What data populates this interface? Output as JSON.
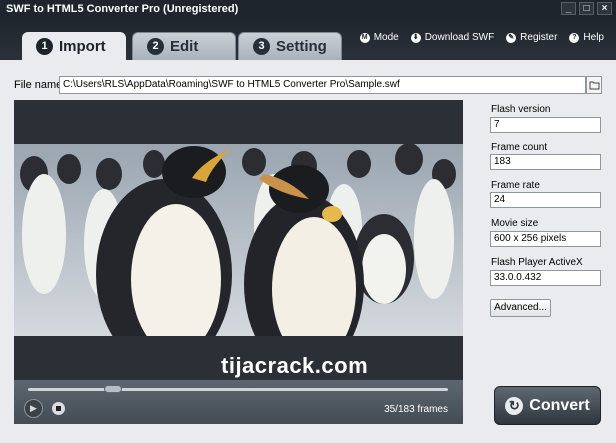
{
  "window": {
    "title": "SWF to HTML5 Converter Pro (Unregistered)",
    "controls": {
      "minimize": "_",
      "maximize": "□",
      "close": "×"
    }
  },
  "tabs": [
    {
      "number": "1",
      "label": "Import",
      "active": true
    },
    {
      "number": "2",
      "label": "Edit",
      "active": false
    },
    {
      "number": "3",
      "label": "Setting",
      "active": false
    }
  ],
  "toplinks": [
    {
      "icon": "mode-icon",
      "glyph": "M",
      "label": "Mode"
    },
    {
      "icon": "download-icon",
      "glyph": "⬇",
      "label": "Download SWF"
    },
    {
      "icon": "register-icon",
      "glyph": "✎",
      "label": "Register"
    },
    {
      "icon": "help-icon",
      "glyph": "?",
      "label": "Help"
    }
  ],
  "file": {
    "label": "File name",
    "value": "C:\\Users\\RLS\\AppData\\Roaming\\SWF to HTML5 Converter Pro\\Sample.swf"
  },
  "info": {
    "flash_version": {
      "label": "Flash version",
      "value": "7"
    },
    "frame_count": {
      "label": "Frame count",
      "value": "183"
    },
    "frame_rate": {
      "label": "Frame rate",
      "value": "24"
    },
    "movie_size": {
      "label": "Movie size",
      "value": "600 x 256 pixels"
    },
    "activex": {
      "label": "Flash Player ActiveX",
      "value": "33.0.0.432"
    },
    "advanced_label": "Advanced..."
  },
  "player": {
    "frames_text": "35/183 frames",
    "progress": 0.19,
    "play_glyph": "▶"
  },
  "watermark": "tijacrack.com",
  "convert_label": "Convert",
  "convert_glyph": "↻"
}
